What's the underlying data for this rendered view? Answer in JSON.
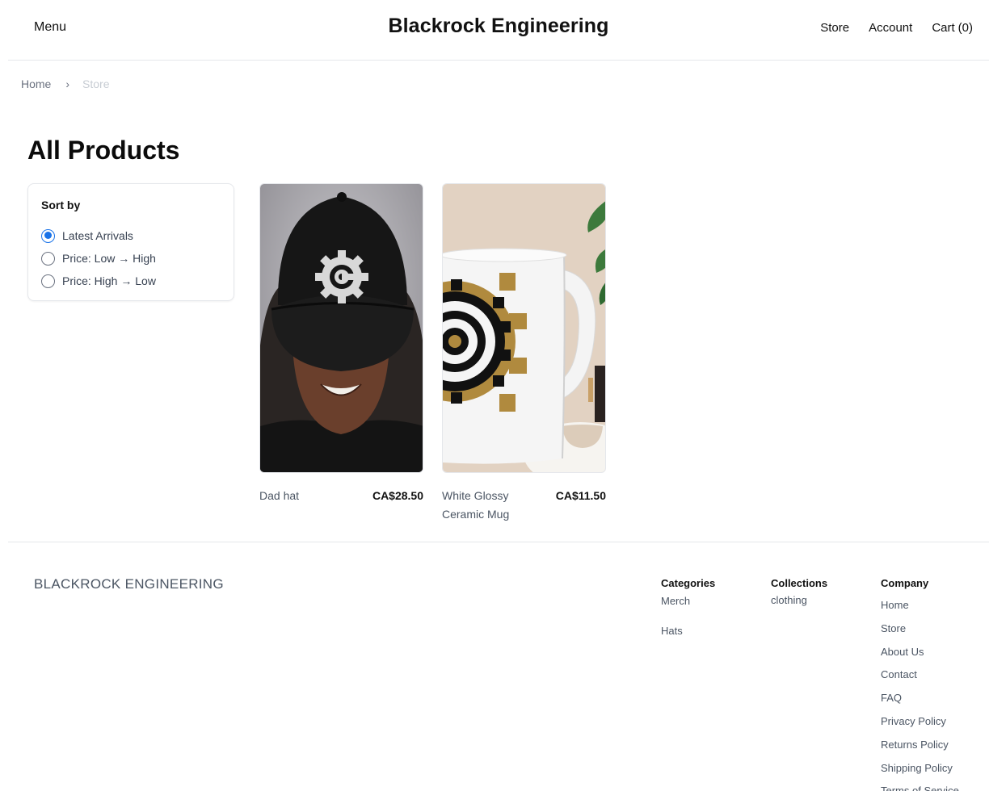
{
  "header": {
    "menu_label": "Menu",
    "brand": "Blackrock Engineering",
    "nav": {
      "store": "Store",
      "account": "Account",
      "cart_label": "Cart",
      "cart_count": "(0)"
    }
  },
  "breadcrumb": {
    "home": "Home",
    "separator": "›",
    "current": "Store"
  },
  "page_title": "All Products",
  "sort": {
    "title": "Sort by",
    "options": [
      {
        "label": "Latest Arrivals",
        "selected": true
      },
      {
        "label": "Price: Low → High",
        "selected": false
      },
      {
        "label": "Price: High → Low",
        "selected": false
      }
    ]
  },
  "products": [
    {
      "name": "Dad hat",
      "price": "CA$28.50",
      "image": "black cap with gear logo worn by smiling person"
    },
    {
      "name": "White Glossy Ceramic Mug",
      "price": "CA$11.50",
      "image": "white mug with gold and black gear logo"
    }
  ],
  "footer": {
    "brand": "BLACKROCK ENGINEERING",
    "categories": {
      "title": "Categories",
      "items": [
        "Merch",
        "Hats"
      ]
    },
    "collections": {
      "title": "Collections",
      "items": [
        "clothing"
      ]
    },
    "company": {
      "title": "Company",
      "items": [
        "Home",
        "Store",
        "About Us",
        "Contact",
        "FAQ",
        "Privacy Policy",
        "Returns Policy",
        "Shipping Policy",
        "Terms of Service"
      ]
    }
  },
  "colors": {
    "radio_accent": "#1a73e8",
    "text_primary": "#111827",
    "text_muted": "#4b5563",
    "border": "#e5e7eb"
  }
}
